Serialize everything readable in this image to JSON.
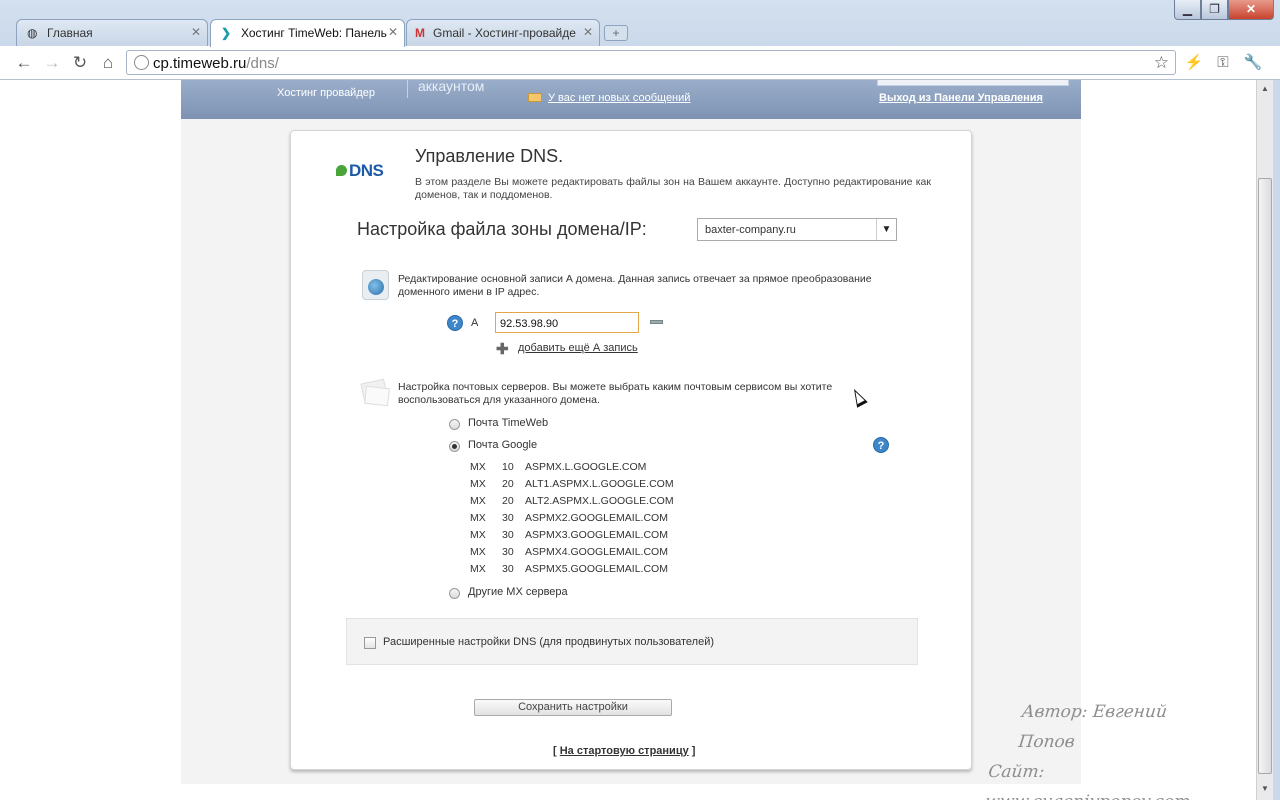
{
  "tabs": [
    {
      "label": "Главная",
      "icon": "globe-icon",
      "active": false
    },
    {
      "label": "Хостинг TimeWeb: Панель",
      "icon": "timeweb-icon",
      "active": true
    },
    {
      "label": "Gmail - Хостинг-провайде",
      "icon": "gmail-icon",
      "active": false
    }
  ],
  "address": {
    "host": "cp.timeweb.ru",
    "path": "/dns/"
  },
  "header": {
    "brand_sub": "Хостинг провайдер",
    "account_word": "аккаунтом",
    "messages": "У вас нет новых сообщений",
    "logout": "Выход из Панели Управления"
  },
  "dns": {
    "logo": "DNS",
    "title": "Управление DNS.",
    "description": "В этом разделе Вы можете редактировать файлы зон на Вашем аккаунте. Доступно редактирование как доменов, так и поддоменов.",
    "zone_label": "Настройка файла зоны домена/IP:",
    "domain": "baxter-company.ru"
  },
  "a_record": {
    "description": "Редактирование основной записи А домена. Данная запись отвечает за прямое преобразование доменного имени в IP адрес.",
    "type": "А",
    "value": "92.53.98.90",
    "add_link": "добавить ещё А запись"
  },
  "mail": {
    "description": "Настройка почтовых серверов. Вы можете выбрать каким почтовым сервисом вы хотите воспользоваться для указанного домена.",
    "options": [
      {
        "label": "Почта TimeWeb",
        "selected": false
      },
      {
        "label": "Почта Google",
        "selected": true
      },
      {
        "label": "Другие MX сервера",
        "selected": false
      }
    ],
    "mx_records": [
      {
        "type": "MX",
        "priority": "10",
        "host": "ASPMX.L.GOOGLE.COM"
      },
      {
        "type": "MX",
        "priority": "20",
        "host": "ALT1.ASPMX.L.GOOGLE.COM"
      },
      {
        "type": "MX",
        "priority": "20",
        "host": "ALT2.ASPMX.L.GOOGLE.COM"
      },
      {
        "type": "MX",
        "priority": "30",
        "host": "ASPMX2.GOOGLEMAIL.COM"
      },
      {
        "type": "MX",
        "priority": "30",
        "host": "ASPMX3.GOOGLEMAIL.COM"
      },
      {
        "type": "MX",
        "priority": "30",
        "host": "ASPMX4.GOOGLEMAIL.COM"
      },
      {
        "type": "MX",
        "priority": "30",
        "host": "ASPMX5.GOOGLEMAIL.COM"
      }
    ]
  },
  "advanced": {
    "label": "Расширенные настройки DNS (для продвинутых пользователей)",
    "checked": false
  },
  "save_label": "Сохранить настройки",
  "home": {
    "open": "[ ",
    "label": "На стартовую страницу",
    "close": " ]"
  },
  "watermark": {
    "author": "Автор: Евгений Попов",
    "site_prefix": "Сайт: ",
    "site_link": "www.evgeniypopov.com"
  },
  "colors": {
    "link_blue": "#1d5aa8",
    "header_band": "#8ea3c1",
    "input_focus": "#e0a64a"
  }
}
